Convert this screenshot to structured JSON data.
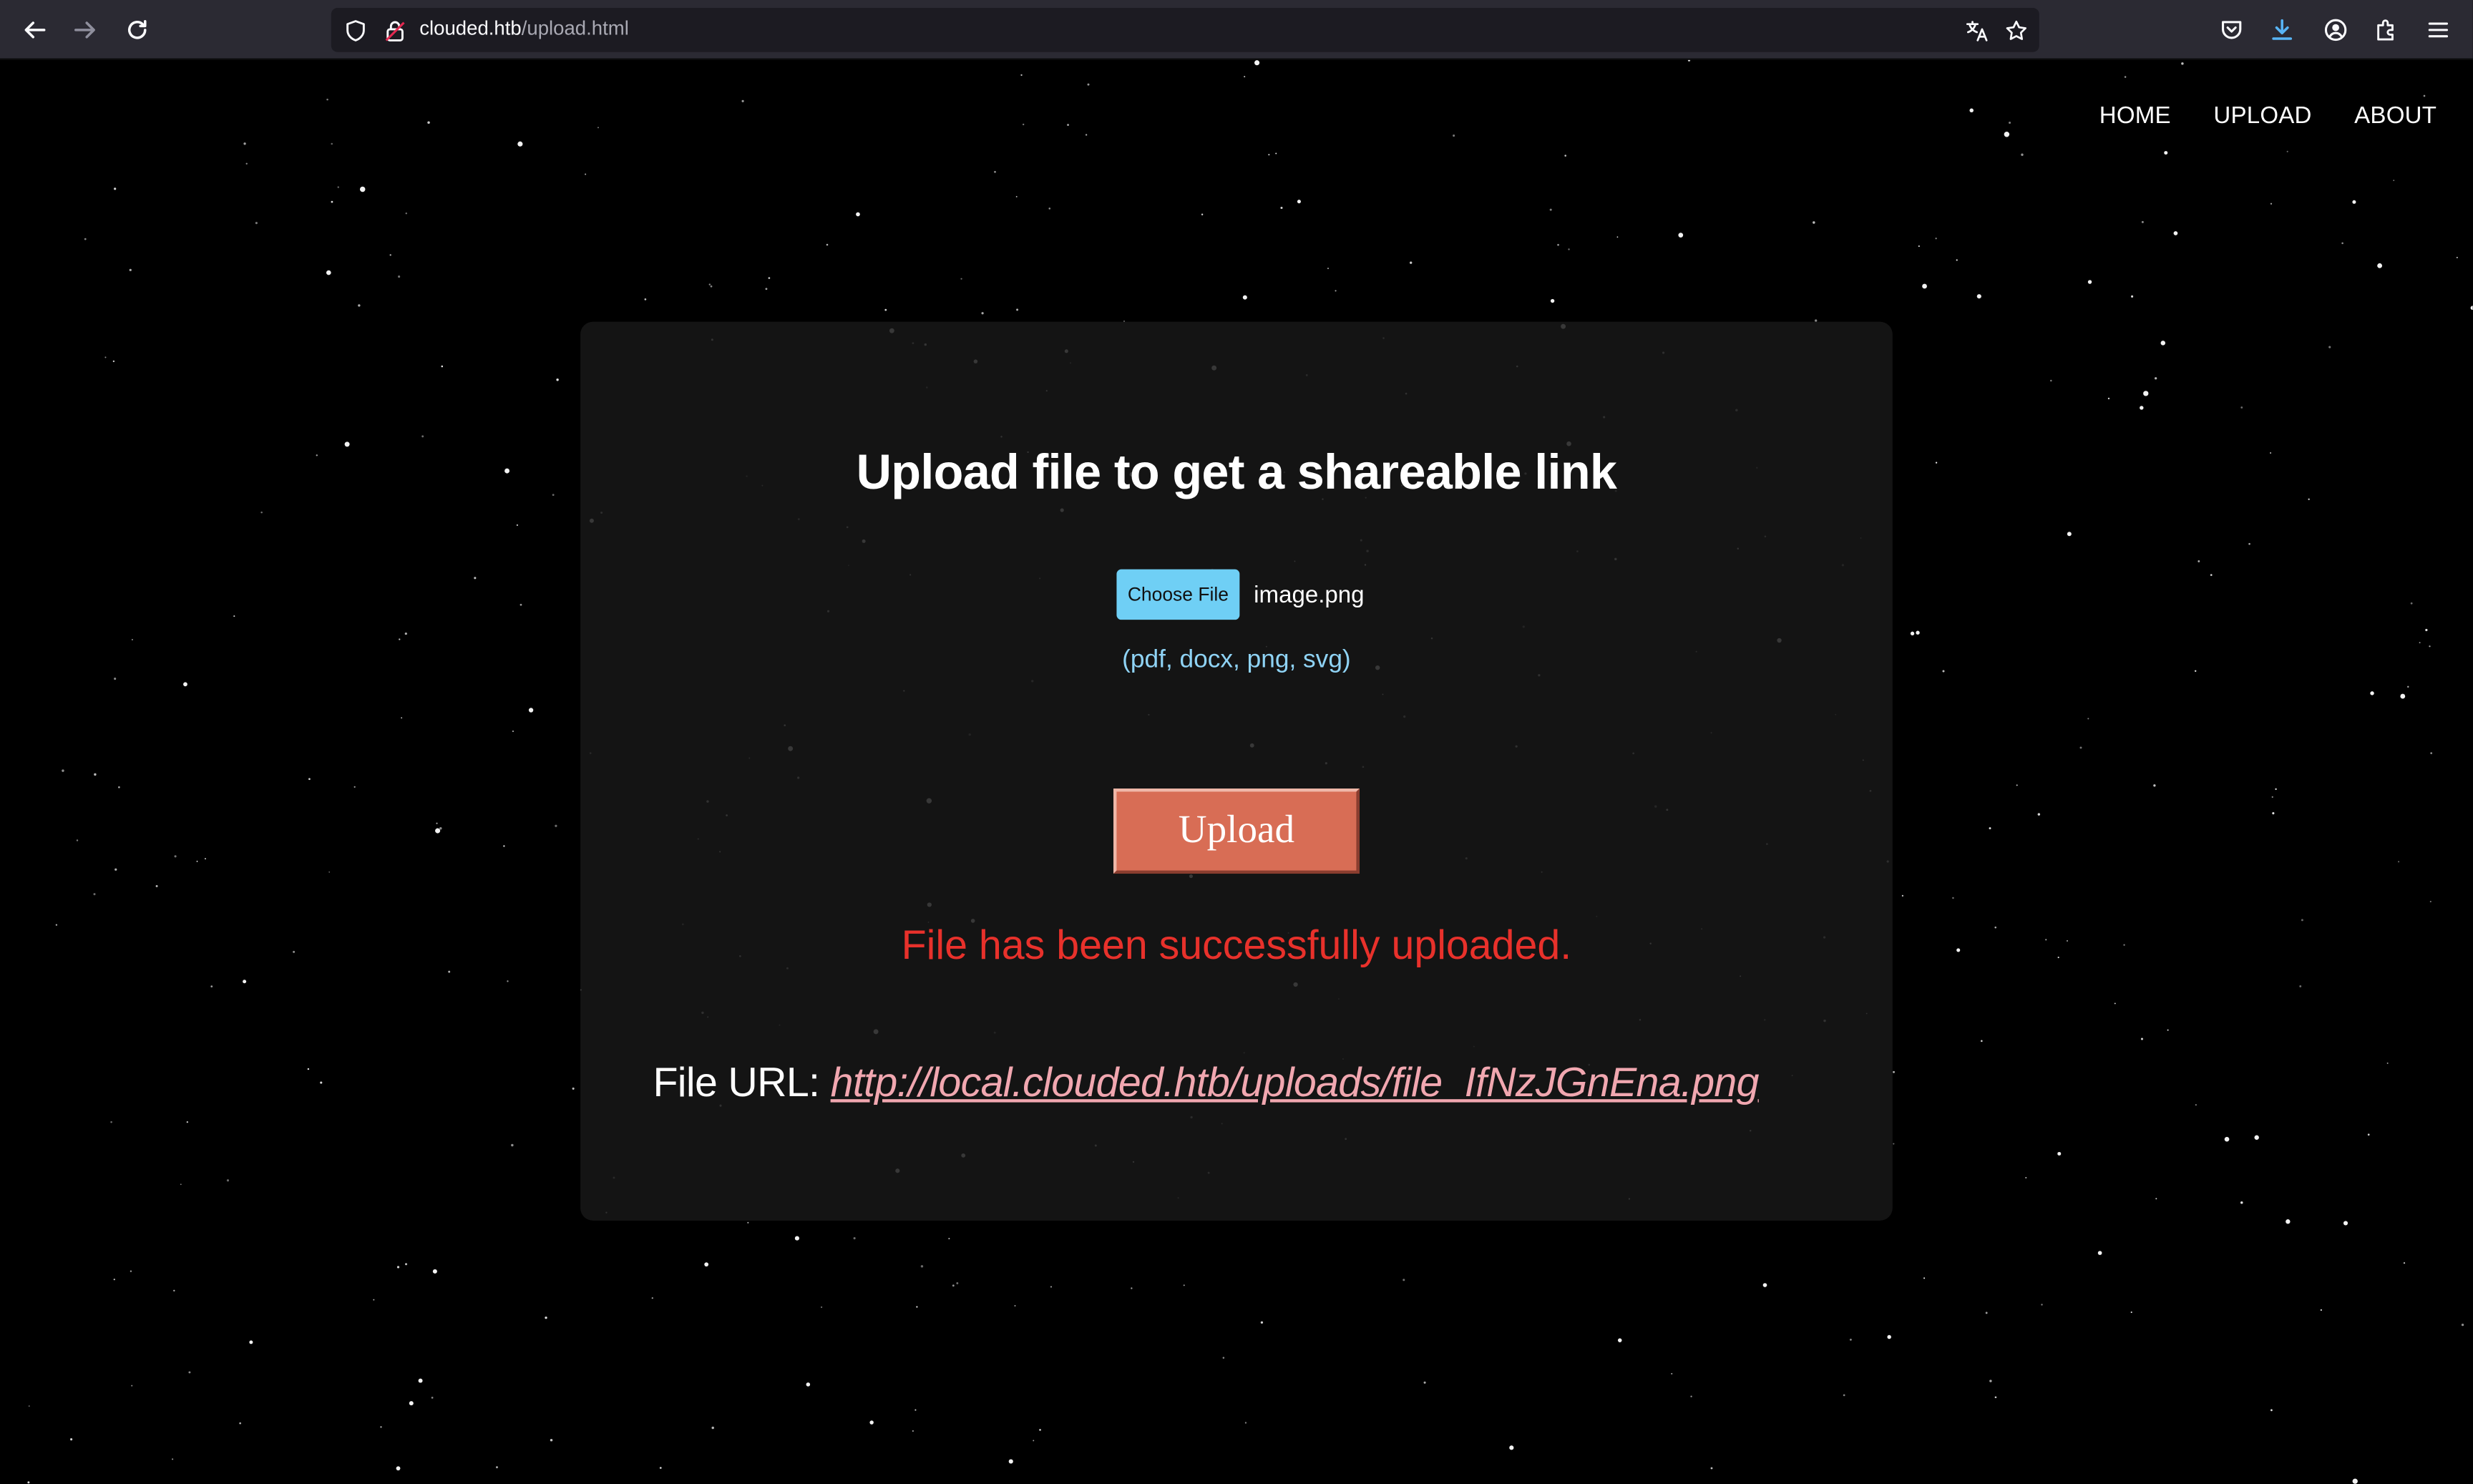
{
  "browser": {
    "url_host": "clouded.htb",
    "url_path": "/upload.html",
    "icons": [
      "back-icon",
      "forward-icon",
      "reload-icon",
      "shield-icon",
      "lock-icon",
      "translate-icon",
      "star-icon",
      "pocket-icon",
      "download-icon",
      "account-icon",
      "extensions-icon",
      "menu-icon"
    ]
  },
  "nav": {
    "home": "HOME",
    "upload": "UPLOAD",
    "about": "ABOUT"
  },
  "upload_form": {
    "title": "Upload file to get a shareable link",
    "choose_file_label": "Choose File",
    "selected_file": "image.png",
    "allowed_types": "(pdf, docx, png, svg)",
    "upload_label": "Upload",
    "status_message": "File has been successfully uploaded.",
    "file_url_label": "File URL:",
    "file_url": "http://local.clouded.htb/uploads/file_IfNzJGnEna.png"
  },
  "colors": {
    "background": "#000000",
    "card": "#181818",
    "choose_button": "#6fcff5",
    "allowed_types_text": "#8fd3f5",
    "upload_button": "#d86d55",
    "status_message": "#e8312b",
    "link": "#f1a7b0"
  }
}
